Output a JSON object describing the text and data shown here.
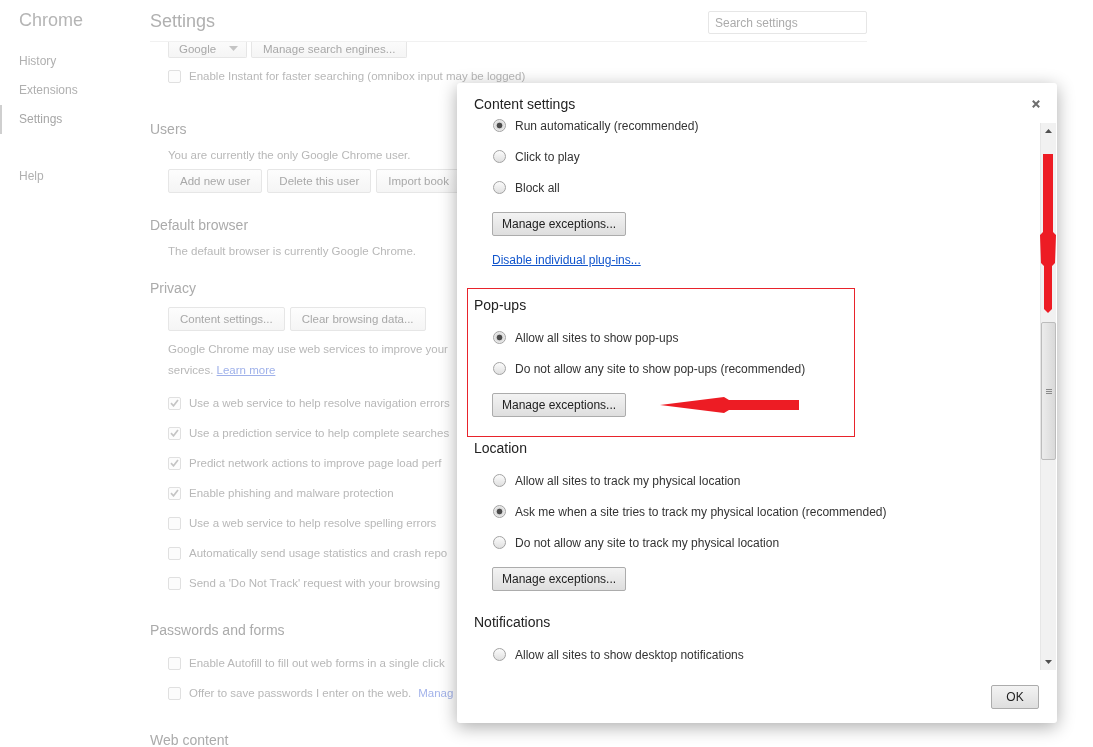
{
  "sidebar": {
    "title": "Chrome",
    "items": [
      {
        "label": "History",
        "selected": false
      },
      {
        "label": "Extensions",
        "selected": false
      },
      {
        "label": "Settings",
        "selected": true
      }
    ],
    "help": {
      "label": "Help",
      "selected": false
    }
  },
  "settings": {
    "title": "Settings",
    "search": {
      "placeholder": "Search settings"
    },
    "sections": [
      {
        "rows": [
          {
            "kind": "controls",
            "dropdown": "Google",
            "buttons": [
              "Manage search engines..."
            ]
          },
          {
            "kind": "checkbox",
            "label": "Enable Instant for faster searching (omnibox input may be logged)",
            "checked": false
          }
        ]
      },
      {
        "heading": "Users",
        "rows": [
          {
            "kind": "text",
            "text": "You are currently the only Google Chrome user."
          },
          {
            "kind": "buttons",
            "buttons": [
              "Add new user",
              "Delete this user",
              "Import book"
            ]
          }
        ]
      },
      {
        "heading": "Default browser",
        "rows": [
          {
            "kind": "text",
            "text": "The default browser is currently Google Chrome."
          }
        ]
      },
      {
        "heading": "Privacy",
        "rows": [
          {
            "kind": "buttons",
            "buttons": [
              "Content settings...",
              "Clear browsing data..."
            ]
          },
          {
            "kind": "text",
            "text": "Google Chrome may use web services to improve your"
          },
          {
            "kind": "text",
            "text": "services.",
            "link": "Learn more"
          },
          {
            "kind": "checkbox",
            "label": "Use a web service to help resolve navigation errors",
            "checked": true
          },
          {
            "kind": "checkbox",
            "label": "Use a prediction service to help complete searches",
            "checked": true
          },
          {
            "kind": "checkbox",
            "label": "Predict network actions to improve page load perf",
            "checked": true
          },
          {
            "kind": "checkbox",
            "label": "Enable phishing and malware protection",
            "checked": true
          },
          {
            "kind": "checkbox",
            "label": "Use a web service to help resolve spelling errors",
            "checked": false
          },
          {
            "kind": "checkbox",
            "label": "Automatically send usage statistics and crash repo",
            "checked": false
          },
          {
            "kind": "checkbox",
            "label": "Send a 'Do Not Track' request with your browsing",
            "checked": false
          }
        ]
      },
      {
        "heading": "Passwords and forms",
        "rows": [
          {
            "kind": "checkbox",
            "label": "Enable Autofill to fill out web forms in a single click",
            "checked": false
          },
          {
            "kind": "checkbox",
            "label": "Offer to save passwords I enter on the web.",
            "checked": false,
            "link": "Manag"
          }
        ]
      },
      {
        "heading": "Web content"
      }
    ]
  },
  "dialog": {
    "title": "Content settings",
    "groups": [
      {
        "options": [
          {
            "label": "Run automatically (recommended)",
            "selected": true
          },
          {
            "label": "Click to play",
            "selected": false
          },
          {
            "label": "Block all",
            "selected": false
          }
        ],
        "button": "Manage exceptions...",
        "link": "Disable individual plug-ins...",
        "highlighted": false
      },
      {
        "heading": "Pop-ups",
        "options": [
          {
            "label": "Allow all sites to show pop-ups",
            "selected": true
          },
          {
            "label": "Do not allow any site to show pop-ups (recommended)",
            "selected": false
          }
        ],
        "button": "Manage exceptions...",
        "highlighted": true
      },
      {
        "heading": "Location",
        "options": [
          {
            "label": "Allow all sites to track my physical location",
            "selected": false
          },
          {
            "label": "Ask me when a site tries to track my physical location (recommended)",
            "selected": true
          },
          {
            "label": "Do not allow any site to track my physical location",
            "selected": false
          }
        ],
        "button": "Manage exceptions...",
        "highlighted": false
      },
      {
        "heading": "Notifications",
        "options": [
          {
            "label": "Allow all sites to show desktop notifications",
            "selected": false
          }
        ],
        "highlighted": false
      }
    ],
    "scroll_arrow": true,
    "ok_button": "OK"
  }
}
